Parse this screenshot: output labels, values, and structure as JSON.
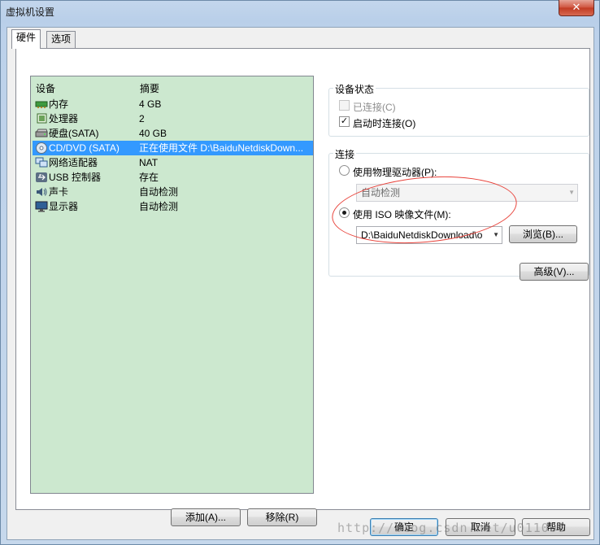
{
  "window": {
    "title": "虚拟机设置",
    "close_glyph": "✕"
  },
  "tabs": [
    {
      "label": "硬件",
      "active": true
    },
    {
      "label": "选项",
      "active": false
    }
  ],
  "device_list": {
    "columns": [
      "设备",
      "摘要"
    ],
    "rows": [
      {
        "name": "内存",
        "summary": "4 GB",
        "icon": "memory-icon"
      },
      {
        "name": "处理器",
        "summary": "2",
        "icon": "processor-icon"
      },
      {
        "name": "硬盘(SATA)",
        "summary": "40 GB",
        "icon": "hard-disk-icon"
      },
      {
        "name": "CD/DVD (SATA)",
        "summary": "正在使用文件 D:\\BaiduNetdiskDown...",
        "icon": "cd-dvd-icon",
        "selected": true
      },
      {
        "name": "网络适配器",
        "summary": "NAT",
        "icon": "network-adapter-icon"
      },
      {
        "name": "USB 控制器",
        "summary": "存在",
        "icon": "usb-icon"
      },
      {
        "name": "声卡",
        "summary": "自动检测",
        "icon": "sound-card-icon"
      },
      {
        "name": "显示器",
        "summary": "自动检测",
        "icon": "display-icon"
      }
    ],
    "add_button": "添加(A)...",
    "remove_button": "移除(R)"
  },
  "device_status": {
    "group_label": "设备状态",
    "connected": {
      "label": "已连接(C)",
      "checked": false,
      "disabled": true
    },
    "connect_on_power_on": {
      "label": "启动时连接(O)",
      "checked": true
    }
  },
  "connection": {
    "group_label": "连接",
    "physical_drive": {
      "label": "使用物理驱动器(P):",
      "selected": false,
      "value": "自动检测"
    },
    "iso_image": {
      "label": "使用 ISO 映像文件(M):",
      "selected": true,
      "value": "D:\\BaiduNetdiskDownload\\o"
    },
    "browse_button": "浏览(B)..."
  },
  "advanced_button": "高级(V)...",
  "footer": {
    "ok": "确定",
    "cancel": "取消",
    "help": "帮助"
  },
  "watermark": "http://blog.csdn.net/u011006"
}
